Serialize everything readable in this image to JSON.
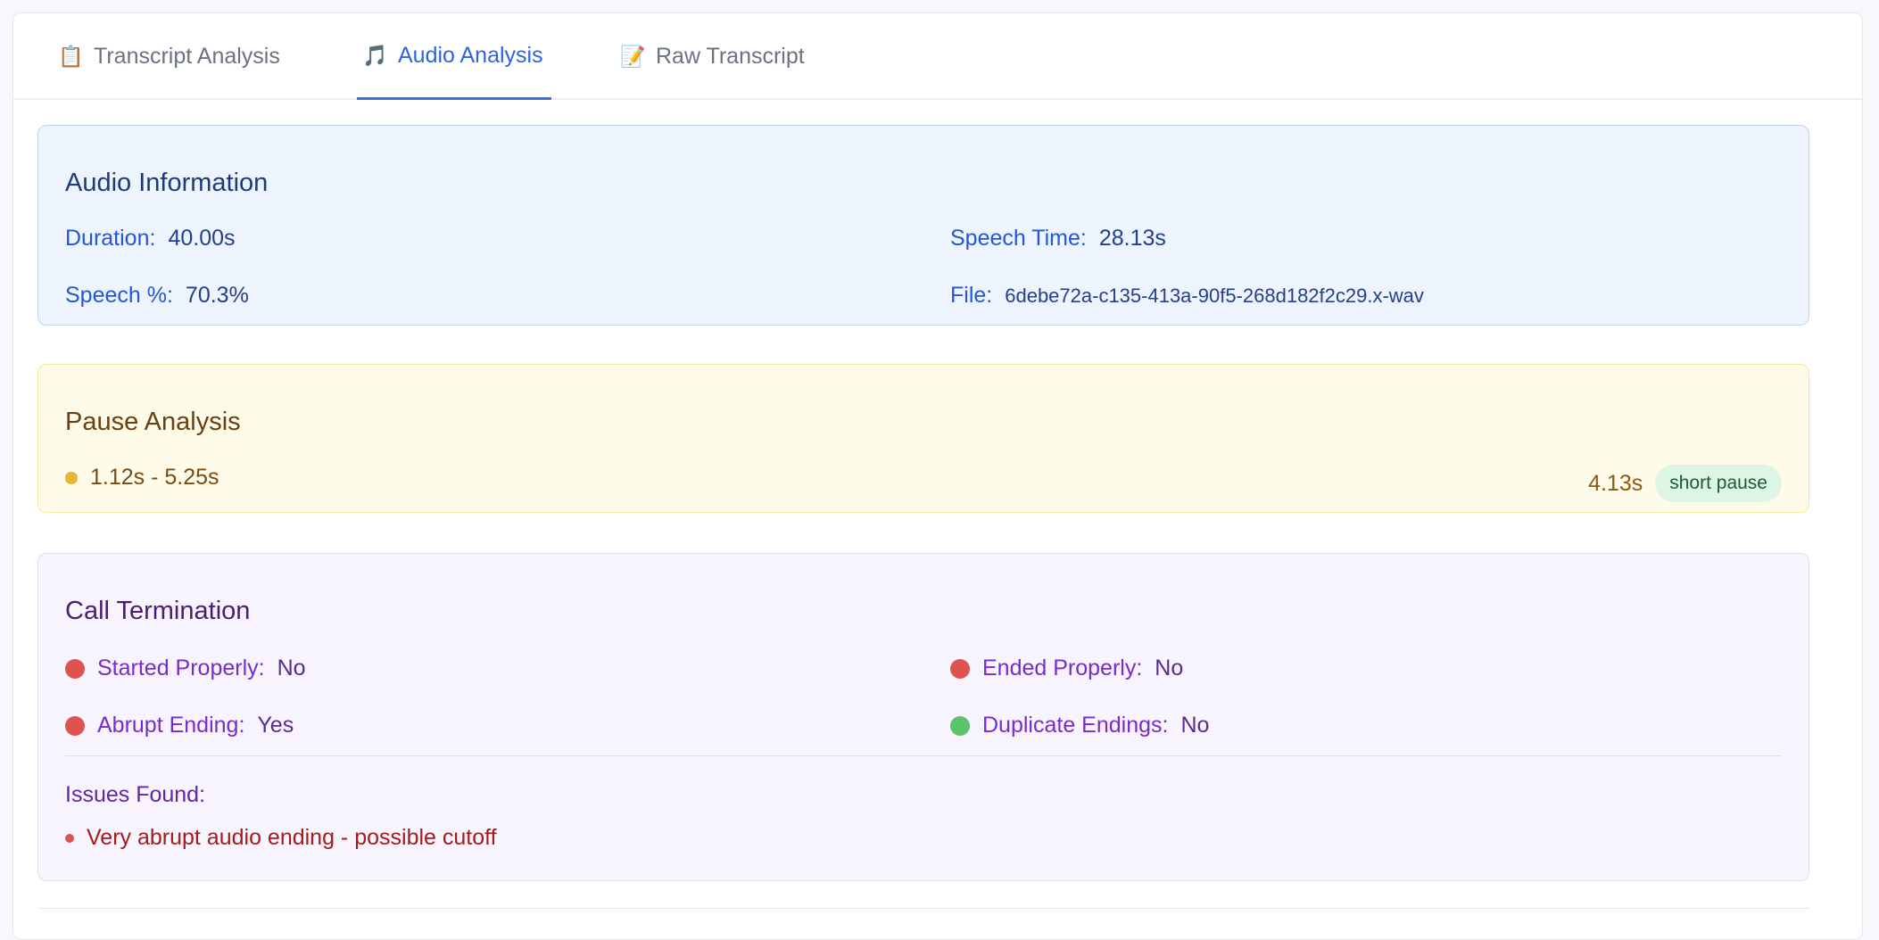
{
  "tabs": [
    {
      "icon": "📋",
      "icon_name": "clipboard-icon",
      "label": "Transcript Analysis",
      "active": false
    },
    {
      "icon": "🎵",
      "icon_name": "music-note-icon",
      "label": "Audio Analysis",
      "active": true
    },
    {
      "icon": "📝",
      "icon_name": "memo-icon",
      "label": "Raw Transcript",
      "active": false
    }
  ],
  "audio_info": {
    "title": "Audio Information",
    "duration_label": "Duration:",
    "duration_value": "40.00s",
    "speech_time_label": "Speech Time:",
    "speech_time_value": "28.13s",
    "speech_pct_label": "Speech %:",
    "speech_pct_value": "70.3%",
    "file_label": "File:",
    "file_value": "6debe72a-c135-413a-90f5-268d182f2c29.x-wav"
  },
  "pause_analysis": {
    "title": "Pause Analysis",
    "pauses": [
      {
        "range": "1.12s - 5.25s",
        "duration": "4.13s",
        "type": "short pause"
      }
    ]
  },
  "call_termination": {
    "title": "Call Termination",
    "started_label": "Started Properly:",
    "started_value": "No",
    "ended_label": "Ended Properly:",
    "ended_value": "No",
    "abrupt_label": "Abrupt Ending:",
    "abrupt_value": "Yes",
    "duplicate_label": "Duplicate Endings:",
    "duplicate_value": "No",
    "issues_title": "Issues Found:",
    "issues": [
      "Very abrupt audio ending - possible cutoff"
    ]
  },
  "colors": {
    "accent": "#2f64e0",
    "status_bad": "#e05252",
    "status_good": "#5cc46a",
    "pause_dot": "#e7b533"
  }
}
